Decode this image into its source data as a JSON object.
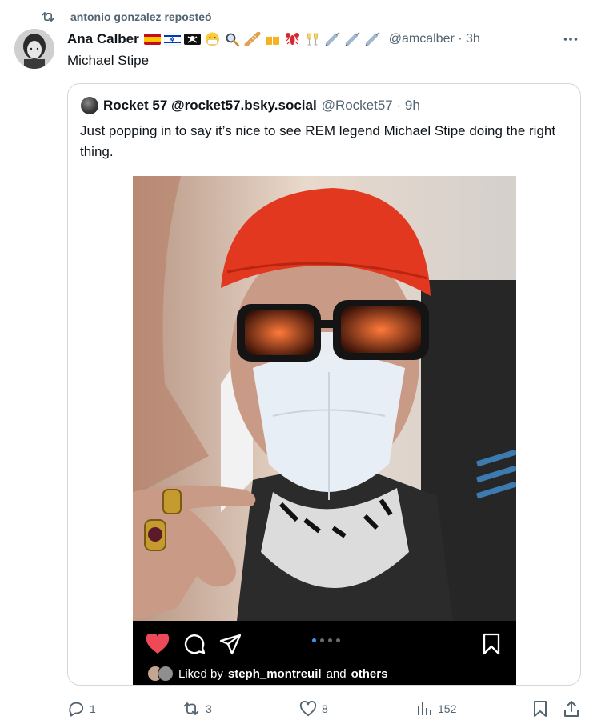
{
  "repost": {
    "text": "antonio gonzalez reposteó"
  },
  "post": {
    "author_name": "Ana Calber",
    "author_handle": "@amcalber · 3h",
    "text": "Michael Stipe",
    "emojis": [
      "spain-flag",
      "israel-flag",
      "pirate-flag",
      "face-with-mask",
      "magnifying-glass",
      "baguette",
      "beer-mugs",
      "lobster",
      "clinking-glasses",
      "syringe",
      "syringe",
      "syringe"
    ]
  },
  "quote": {
    "author_name": "Rocket 57 @rocket57.bsky.social",
    "author_handle": "@Rocket57 · 9h",
    "text": "Just popping in to say it’s nice to see REM legend Michael Stipe doing the right thing.",
    "liked_by_prefix": "Liked by",
    "liked_by_user": "steph_montreuil",
    "liked_by_and": "and",
    "liked_by_others": "others"
  },
  "actions": {
    "reply_count": "1",
    "repost_count": "3",
    "like_count": "8",
    "view_count": "152"
  },
  "colors": {
    "text_primary": "#0f1419",
    "text_secondary": "#536471",
    "border": "#cfd9de",
    "ig_like_red": "#ed4956",
    "ig_dot_active": "#3897f0"
  }
}
